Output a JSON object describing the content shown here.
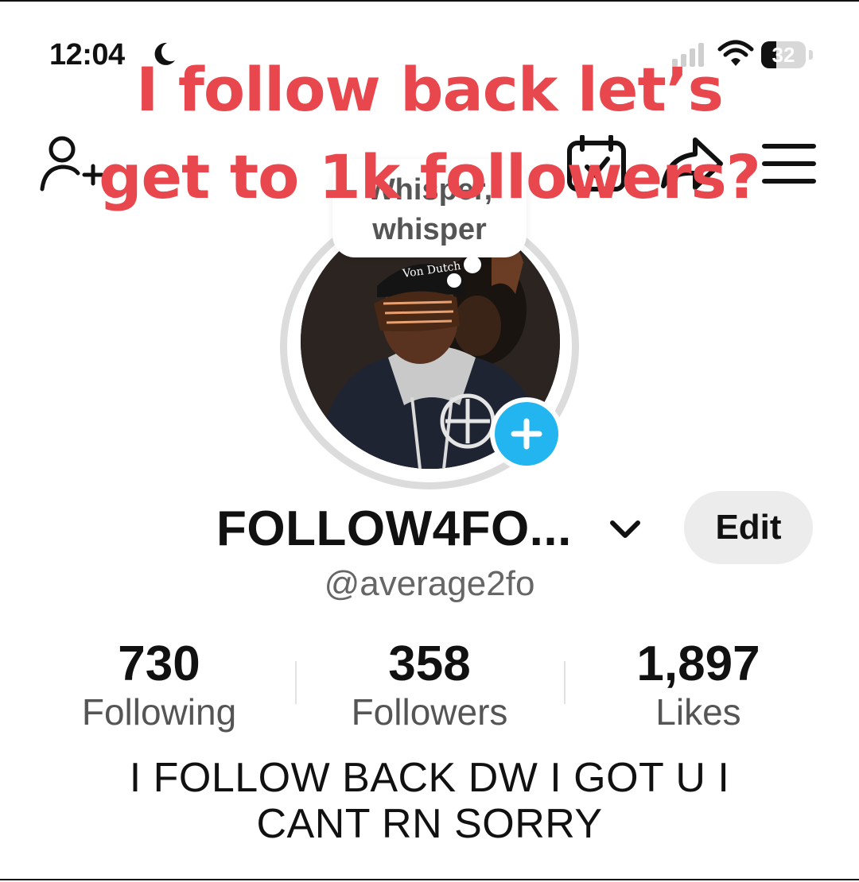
{
  "status_bar": {
    "time": "12:04",
    "battery": "32",
    "icons": [
      "moon-icon",
      "signal-icon",
      "wifi-icon",
      "battery-icon"
    ]
  },
  "overlay_caption": {
    "line1": "I follow back let’s",
    "line2": "get to 1k followers?",
    "color": "#e8474d"
  },
  "header": {
    "icons": [
      "add-friend-icon",
      "calendar-icon",
      "share-icon",
      "menu-icon"
    ]
  },
  "avatar": {
    "thought_bubble_text": "Whisper, whisper",
    "badge_icon": "plus-icon",
    "badge_color": "#22b5f0"
  },
  "profile": {
    "display_name": "FOLLOW4FO...",
    "edit_label": "Edit",
    "handle": "@average2fo",
    "bio": "I FOLLOW BACK DW I GOT U I CANT RN SORRY"
  },
  "stats": [
    {
      "value": "730",
      "label": "Following"
    },
    {
      "value": "358",
      "label": "Followers"
    },
    {
      "value": "1,897",
      "label": "Likes"
    }
  ]
}
